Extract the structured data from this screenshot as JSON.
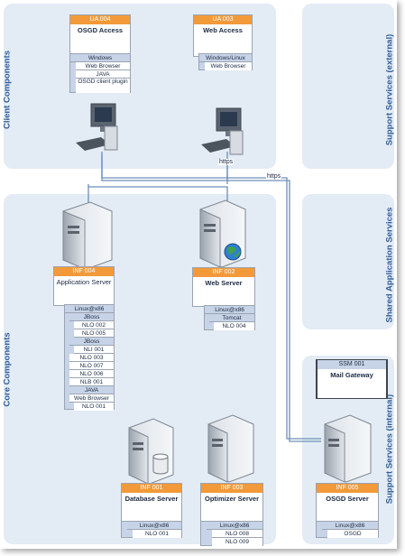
{
  "zones": {
    "client": "Client Components",
    "core": "Core Components",
    "support_ext": "Support Services (external)",
    "shared": "Shared Application Services",
    "support_int": "Support Services (internal)"
  },
  "links": {
    "https1": "https",
    "https2": "https"
  },
  "ua004": {
    "id": "UA 004",
    "title": "OSGD Access",
    "items": [
      "Windows",
      "Web Browser",
      "JAVA",
      "OSGD client plugin"
    ]
  },
  "ua003": {
    "id": "UA 003",
    "title": "Web Access",
    "items": [
      "Windows/Linux",
      "Web Browser"
    ]
  },
  "inf004": {
    "id": "INF 004",
    "title": "Application Server",
    "items": [
      "Linux@x86",
      "JBoss",
      "NLO 002",
      "NLO 005",
      "JBoss",
      "NLI 001",
      "NLO 003",
      "NLO 007",
      "NLO 006",
      "NLB 001",
      "JAVA",
      "Web Browser",
      "NLO 001"
    ]
  },
  "inf002": {
    "id": "INF 002",
    "title": "Web Server",
    "items": [
      "Linux@x86",
      "Tomcat",
      "NLO 004"
    ]
  },
  "ssm001": {
    "id": "SSM 001",
    "title": "Mail Gateway"
  },
  "inf001": {
    "id": "INF 001",
    "title": "Database Server",
    "items": [
      "Linux@x86",
      "NLO 001"
    ]
  },
  "inf003": {
    "id": "INF 003",
    "title": "Optimizer Server",
    "items": [
      "Linux@x86",
      "NLO 008",
      "NLO 009"
    ]
  },
  "inf005": {
    "id": "INF 005",
    "title": "OSGD Server",
    "items": [
      "Linux@x86",
      "OSGD"
    ]
  }
}
